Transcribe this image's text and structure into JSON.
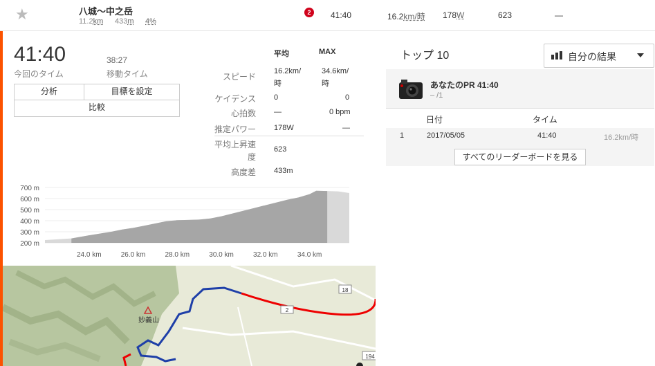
{
  "segment": {
    "name": "八城～中之岳",
    "distance_val": "11.2",
    "distance_unit": "km",
    "elev_val": "433",
    "elev_unit": "m",
    "grade": "4%",
    "rank": "2",
    "time": "41:40",
    "speed_val": "16.2",
    "speed_unit": "km/時",
    "power_val": "178",
    "power_unit": "W",
    "vam": "623",
    "hr": "—"
  },
  "summary": {
    "elapsed": "41:40",
    "elapsed_label": "今回のタイム",
    "moving": "38:27",
    "moving_label": "移動タイム",
    "buttons": {
      "analysis": "分析",
      "goal": "目標を設定",
      "compare": "比較"
    }
  },
  "stats": {
    "col_avg": "平均",
    "col_max": "MAX",
    "rows": [
      {
        "label": "スピード",
        "avg": "16.2km/時",
        "max": "34.6km/時"
      },
      {
        "label": "ケイデンス",
        "avg": "0",
        "max": "0"
      },
      {
        "label": "心拍数",
        "avg": "—",
        "max": "0 bpm"
      },
      {
        "label": "推定パワー",
        "avg": "178W",
        "max": "—"
      },
      {
        "label": "平均上昇速度",
        "avg": "623",
        "max": ""
      },
      {
        "label": "高度差",
        "avg": "433m",
        "max": ""
      }
    ]
  },
  "leaderboard": {
    "title": "トップ 10",
    "filter": "自分の結果",
    "pr_label": "あなたのPR 41:40",
    "pr_rank": "– /1",
    "col_date": "日付",
    "col_time": "タイム",
    "rows": [
      {
        "rank": "1",
        "date": "2017/05/05",
        "time": "41:40",
        "speed": "16.2km/時"
      }
    ],
    "see_all": "すべてのリーダーボードを見る"
  },
  "chart_data": {
    "type": "area",
    "y_ticks": [
      "700 m",
      "600 m",
      "500 m",
      "400 m",
      "300 m",
      "200 m"
    ],
    "x_ticks": [
      "24.0 km",
      "26.0 km",
      "28.0 km",
      "30.0 km",
      "32.0 km",
      "34.0 km"
    ],
    "ylim": [
      200,
      700
    ],
    "xlim": [
      22.0,
      35.8
    ],
    "segment_range_km": [
      23.2,
      34.8
    ],
    "x": [
      22.0,
      23.2,
      24.0,
      25.0,
      25.5,
      26.0,
      26.5,
      27.0,
      27.5,
      28.0,
      28.5,
      29.0,
      29.5,
      30.0,
      30.5,
      31.0,
      31.5,
      32.0,
      32.5,
      33.0,
      33.5,
      34.0,
      34.3,
      34.8,
      35.3,
      35.8
    ],
    "y": [
      225,
      240,
      268,
      300,
      320,
      335,
      355,
      375,
      395,
      405,
      407,
      410,
      420,
      440,
      465,
      490,
      515,
      540,
      565,
      590,
      610,
      640,
      670,
      668,
      665,
      650
    ]
  },
  "map": {
    "mountain_label": "妙義山",
    "road_labels": [
      "18",
      "2",
      "194"
    ]
  }
}
